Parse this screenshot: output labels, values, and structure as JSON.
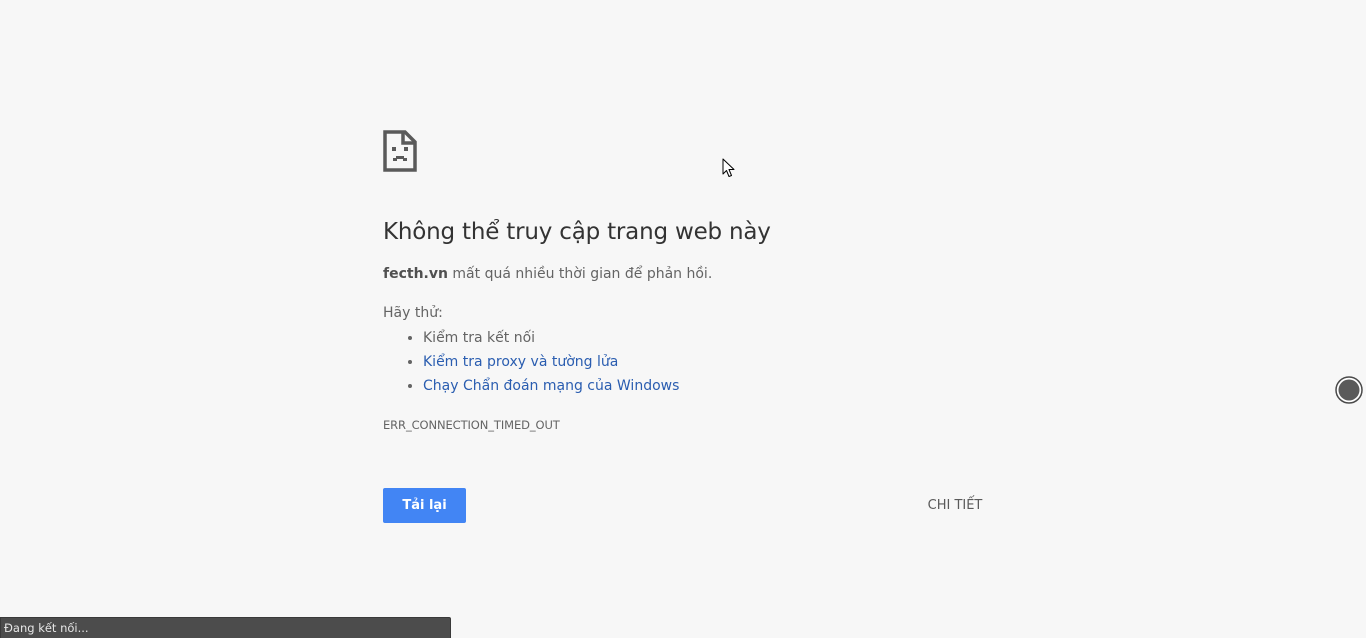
{
  "error": {
    "title": "Không thể truy cập trang web này",
    "domain": "fecth.vn",
    "summary_rest": " mất quá nhiều thời gian để phản hồi.",
    "try_label": "Hãy thử:",
    "suggestions": [
      {
        "label": "Kiểm tra kết nối",
        "is_link": false
      },
      {
        "label": "Kiểm tra proxy và tường lửa",
        "is_link": true
      },
      {
        "label": "Chạy Chẩn đoán mạng của Windows",
        "is_link": true
      }
    ],
    "code": "ERR_CONNECTION_TIMED_OUT",
    "icon": "sad-page-icon"
  },
  "buttons": {
    "reload_label": "Tải lại",
    "details_label": "CHI TIẾT"
  },
  "status_bar": {
    "text": "Đang kết nối..."
  },
  "colors": {
    "background": "#f7f7f7",
    "link": "#2a5db0",
    "primary_button": "#4285f4",
    "status_bar": "#4c4c4c"
  }
}
